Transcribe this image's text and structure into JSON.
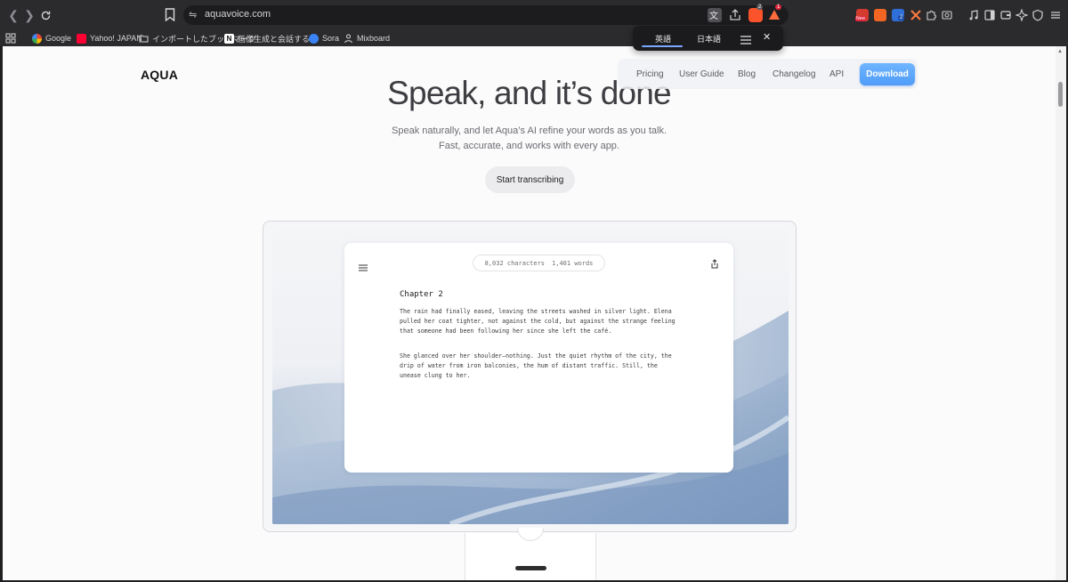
{
  "browser": {
    "url": "aquavoice.com",
    "bookmarks": [
      {
        "label": "Google",
        "icon": "google-icon",
        "color": "#ea4335"
      },
      {
        "label": "Yahoo! JAPAN",
        "icon": "yahoo-icon",
        "color": "#ff0033"
      },
      {
        "label": "インポートしたブックマーク",
        "icon": "folder-icon",
        "color": "#d8d8db"
      },
      {
        "label": "画像生成と会話する...",
        "icon": "notion-icon",
        "color": "#ffffff"
      },
      {
        "label": "Sora",
        "icon": "sora-icon",
        "color": "#3b82f6"
      },
      {
        "label": "Mixboard",
        "icon": "mixboard-icon",
        "color": "#d8d8db"
      }
    ],
    "badges": {
      "brave_count": "2",
      "alert_count": "1",
      "ext_new": "New",
      "ext_count": "2"
    }
  },
  "translate_popup": {
    "tab_source": "英語",
    "tab_target": "日本語"
  },
  "site": {
    "logo": "AQUA",
    "nav": [
      "Pricing",
      "User Guide",
      "Blog",
      "Changelog",
      "API"
    ],
    "download_label": "Download",
    "accent_color": "#4f9cf8"
  },
  "hero": {
    "title": "Speak, and it’s done",
    "subtitle_line1": "Speak naturally, and let Aqua’s AI refine your words as you talk.",
    "subtitle_line2": "Fast, accurate, and works with every app.",
    "cta_label": "Start transcribing"
  },
  "document": {
    "characters": "8,032 characters",
    "words": "1,401 words",
    "heading": "Chapter 2",
    "paragraphs": [
      "The rain had finally eased, leaving the streets washed in silver light. Elena pulled her coat tighter, not against the cold, but against the strange feeling that someone had been following her since she left the café.",
      "She glanced over her shoulder—nothing. Just the quiet rhythm of the city, the drip of water from iron balconies, the hum of distant traffic. Still, the unease clung to her."
    ]
  }
}
